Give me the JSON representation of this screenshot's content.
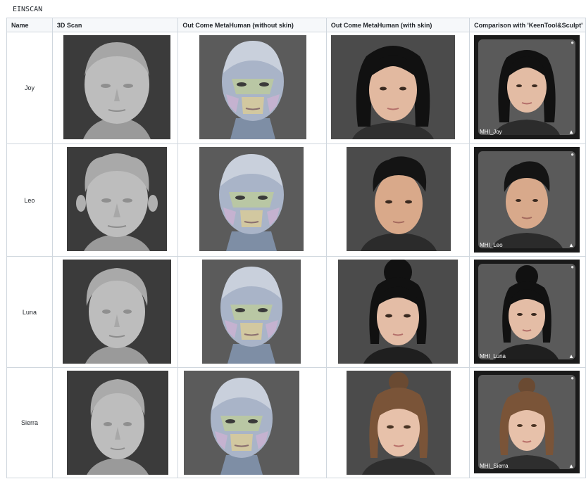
{
  "title": "EINSCAN",
  "columns": [
    "Name",
    "3D Scan",
    "Out Come MetaHuman (without skin)",
    "Out Come MetaHuman (with skin)",
    "Comparison with 'KeenTool&Sculpt'"
  ],
  "rows": [
    {
      "name": "Joy",
      "caption": "MHI_Joy"
    },
    {
      "name": "Leo",
      "caption": "MHI_Leo"
    },
    {
      "name": "Luna",
      "caption": "MHI_Luna"
    },
    {
      "name": "Sierra",
      "caption": "MHI_Sierra"
    }
  ],
  "icons": {
    "warning": "warning-icon",
    "settings": "bust-icon"
  },
  "colors": {
    "header_bg": "#f6f8fa",
    "border": "#d0d7de",
    "scan_bg": "#3b3b3b",
    "mesh_head": "#a9b4c8"
  }
}
